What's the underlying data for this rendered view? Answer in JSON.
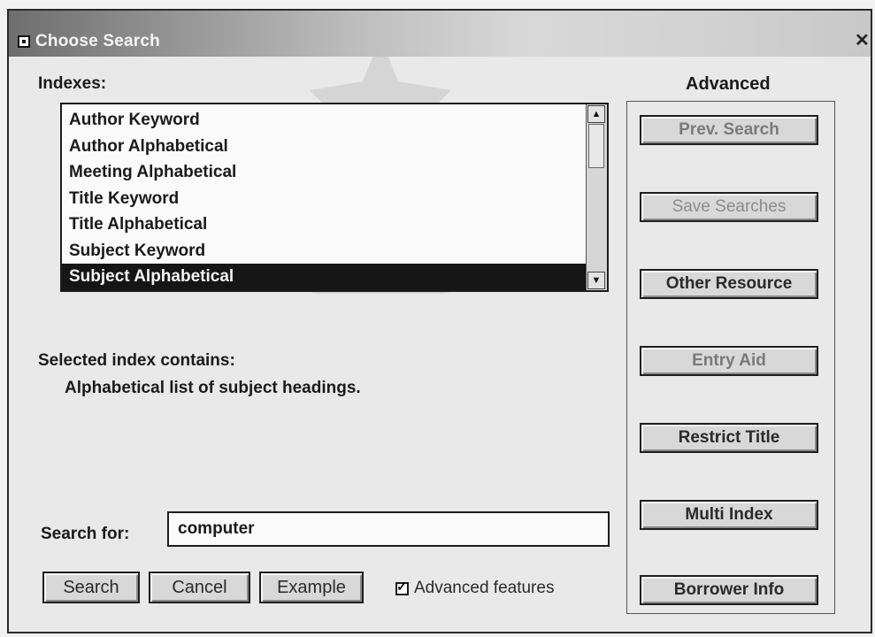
{
  "window": {
    "title": "Choose Search"
  },
  "indexes": {
    "label": "Indexes:",
    "items": [
      "Author Keyword",
      "Author Alphabetical",
      "Meeting Alphabetical",
      "Title Keyword",
      "Title Alphabetical",
      "Subject Keyword",
      "Subject Alphabetical"
    ],
    "selected_index": 6
  },
  "description": {
    "label": "Selected index contains:",
    "text": "Alphabetical list of subject headings."
  },
  "search": {
    "label": "Search for:",
    "value": "computer"
  },
  "actions": {
    "search_label": "Search",
    "cancel_label": "Cancel",
    "example_label": "Example",
    "advanced_features_label": "Advanced features",
    "advanced_features_checked": true
  },
  "advanced": {
    "heading": "Advanced",
    "buttons": [
      {
        "label": "Prev. Search",
        "state": "dimmed"
      },
      {
        "label": "Save Searches",
        "state": "disabled"
      },
      {
        "label": "Other Resource",
        "state": "enabled"
      },
      {
        "label": "Entry Aid",
        "state": "dimmed"
      },
      {
        "label": "Restrict Title",
        "state": "enabled"
      },
      {
        "label": "Multi Index",
        "state": "enabled"
      },
      {
        "label": "Borrower Info",
        "state": "enabled"
      }
    ]
  }
}
